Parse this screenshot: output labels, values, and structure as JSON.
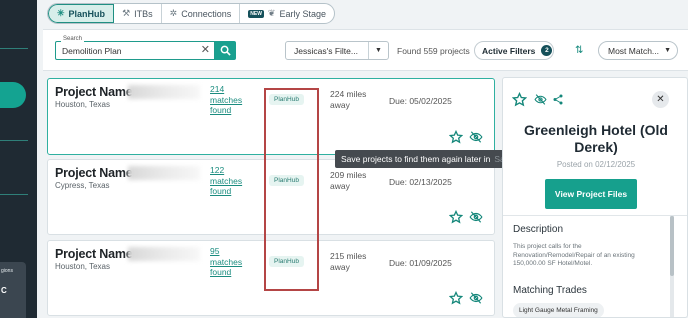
{
  "tabs": [
    {
      "label": "PlanHub",
      "icon": "planhub-icon",
      "active": true
    },
    {
      "label": "ITBs",
      "icon": "itb-icon"
    },
    {
      "label": "Connections",
      "icon": "connections-icon"
    },
    {
      "label": "Early Stage",
      "icon": "early-stage-icon",
      "badge": "NEW"
    }
  ],
  "search": {
    "label": "Search",
    "value": "Demolition Plan"
  },
  "saved_search": {
    "value": "Jessicas's Filte..."
  },
  "results": {
    "found_text": "Found 559 projects"
  },
  "active_filters": {
    "label": "Active Filters",
    "count": "2"
  },
  "sort": {
    "value": "Most Match..."
  },
  "projects": [
    {
      "name": "Project Name",
      "location": "Houston, Texas",
      "matches": "214 matches found",
      "tag": "PlanHub",
      "miles": "224 miles away",
      "due": "Due: 05/02/2025",
      "selected": true
    },
    {
      "name": "Project Name",
      "location": "Cypress, Texas",
      "matches": "122 matches found",
      "tag": "PlanHub",
      "miles": "209 miles away",
      "due": "Due: 02/13/2025"
    },
    {
      "name": "Project Name",
      "location": "Houston, Texas",
      "matches": "95 matches found",
      "tag": "PlanHub",
      "miles": "215 miles away",
      "due": "Due: 01/09/2025"
    }
  ],
  "tooltip": {
    "text": "Save projects to find them again later in",
    "tail": "Saved Projects"
  },
  "details": {
    "title": "Greenleigh Hotel (Old Derek)",
    "posted": "Posted on 02/12/2025",
    "view_files": "View Project Files",
    "description_heading": "Description",
    "description": "This project calls for the Renovation/Remodel/Repair of an existing 150,000.00 SF Hotel/Motel.",
    "trades_heading": "Matching Trades",
    "trade": "Light Gauge Metal Framing"
  },
  "sidebar": {
    "region_label": "gions",
    "region_value": "C"
  },
  "colors": {
    "accent": "#16a08d",
    "dark": "#1f2a33",
    "annotation": "#b44545"
  }
}
